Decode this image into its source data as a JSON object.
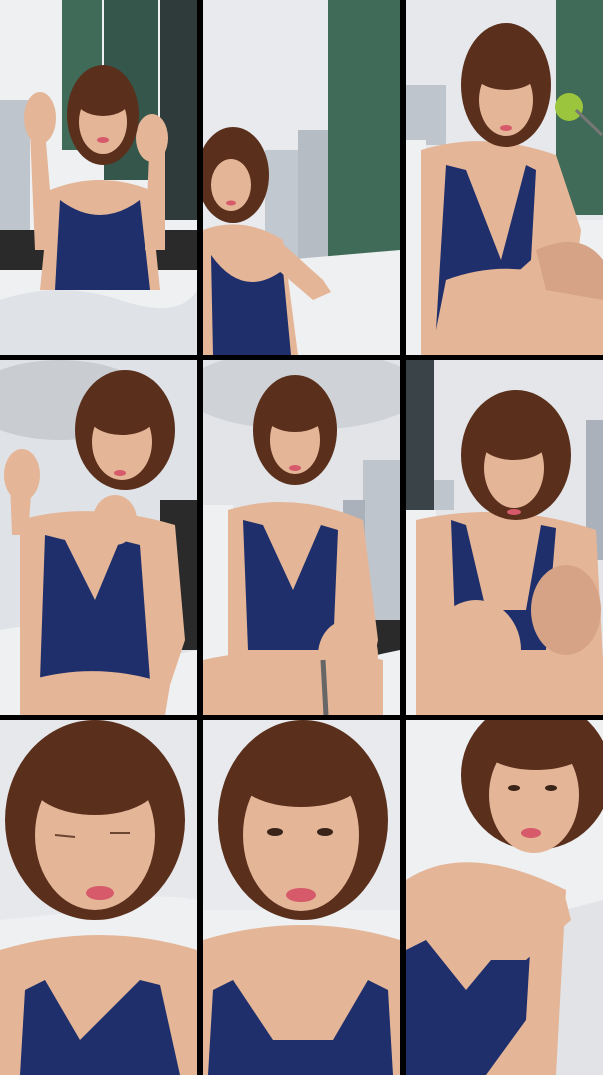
{
  "layout": {
    "columns": 3,
    "rows": 3
  },
  "palette": {
    "sky": "#e6e8ec",
    "cloud": "#d3d6db",
    "building_glass": "#3f6b58",
    "building_dark": "#2e3b3a",
    "building_light": "#bfc5cc",
    "towel": "#eef0f2",
    "towel_shadow": "#c9ccd1",
    "skin": "#e4b597",
    "skin_shadow": "#c9917a",
    "hair": "#5a2f1c",
    "swimsuit": "#1e2f6b",
    "swimsuit_shadow": "#14204d",
    "lips": "#d65a6a",
    "rail": "#2a2a2a",
    "lime": "#9bc53d"
  },
  "frames": [
    {
      "id": "frame-1",
      "scene": "rooftop",
      "pose": "waving-hands"
    },
    {
      "id": "frame-2",
      "scene": "rooftop",
      "pose": "leaning-left"
    },
    {
      "id": "frame-3",
      "scene": "rooftop",
      "pose": "seated-with-lime"
    },
    {
      "id": "frame-4",
      "scene": "cloudy-rooftop",
      "pose": "hand-raised"
    },
    {
      "id": "frame-5",
      "scene": "cloudy-rooftop",
      "pose": "holding-stick"
    },
    {
      "id": "frame-6",
      "scene": "cloudy-rooftop",
      "pose": "knees-up"
    },
    {
      "id": "frame-7",
      "scene": "towel-closeup",
      "pose": "eyes-closed"
    },
    {
      "id": "frame-8",
      "scene": "towel-closeup",
      "pose": "face-closeup"
    },
    {
      "id": "frame-9",
      "scene": "towel-closeup",
      "pose": "hand-on-shoulder"
    }
  ]
}
